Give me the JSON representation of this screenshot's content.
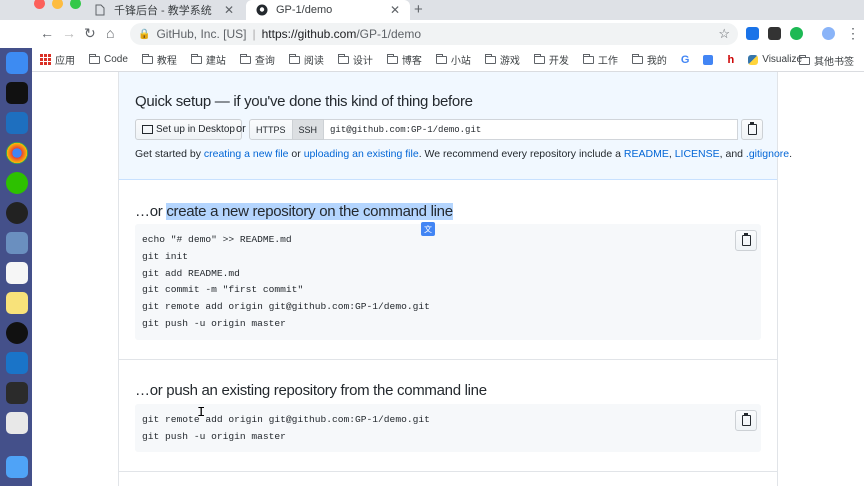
{
  "browser": {
    "tabs": [
      {
        "title": "千锋后台 - 教学系统",
        "active": false
      },
      {
        "title": "GP-1/demo",
        "active": true
      }
    ],
    "address": {
      "org": "GitHub, Inc. [US]",
      "host": "https://github.com",
      "path": "/GP-1/demo"
    },
    "bookmarks": [
      {
        "label": "应用",
        "icon": "apps-grid-icon"
      },
      {
        "label": "Code",
        "icon": "folder-icon"
      },
      {
        "label": "教程",
        "icon": "folder-icon"
      },
      {
        "label": "建站",
        "icon": "folder-icon"
      },
      {
        "label": "查询",
        "icon": "folder-icon"
      },
      {
        "label": "阅读",
        "icon": "folder-icon"
      },
      {
        "label": "设计",
        "icon": "folder-icon"
      },
      {
        "label": "博客",
        "icon": "folder-icon"
      },
      {
        "label": "小站",
        "icon": "folder-icon"
      },
      {
        "label": "游戏",
        "icon": "folder-icon"
      },
      {
        "label": "开发",
        "icon": "folder-icon"
      },
      {
        "label": "工作",
        "icon": "folder-icon"
      },
      {
        "label": "我的",
        "icon": "folder-icon"
      },
      {
        "label": "Visualize",
        "icon": "python-icon"
      }
    ],
    "other_bookmarks": "其他书签"
  },
  "quick_setup": {
    "title": "Quick setup — if you've done this kind of thing before",
    "desktop_button": "Set up in Desktop",
    "or": "or",
    "https_label": "HTTPS",
    "ssh_label": "SSH",
    "clone_url": "git@github.com:GP-1/demo.git",
    "get_started_prefix": "Get started by ",
    "link_new_file": "creating a new file",
    "middle_or": " or ",
    "link_upload": "uploading an existing file",
    "recommend": ". We recommend every repository include a ",
    "link_readme": "README",
    "comma": ", ",
    "link_license": "LICENSE",
    "and": ", and ",
    "link_gitignore": ".gitignore",
    "period": "."
  },
  "create_section": {
    "title_prefix": "…or ",
    "title_highlight": "create a new repository on the command line",
    "code": "echo \"# demo\" >> README.md\ngit init\ngit add README.md\ngit commit -m \"first commit\"\ngit remote add origin git@github.com:GP-1/demo.git\ngit push -u origin master"
  },
  "push_section": {
    "title": "…or push an existing repository from the command line",
    "code": "git remote add origin git@github.com:GP-1/demo.git\ngit push -u origin master"
  },
  "colors": {
    "link": "#0366d6",
    "quick_setup_bg": "#f1f8ff",
    "selection": "#b4d5fe",
    "dock": "#44508a"
  }
}
